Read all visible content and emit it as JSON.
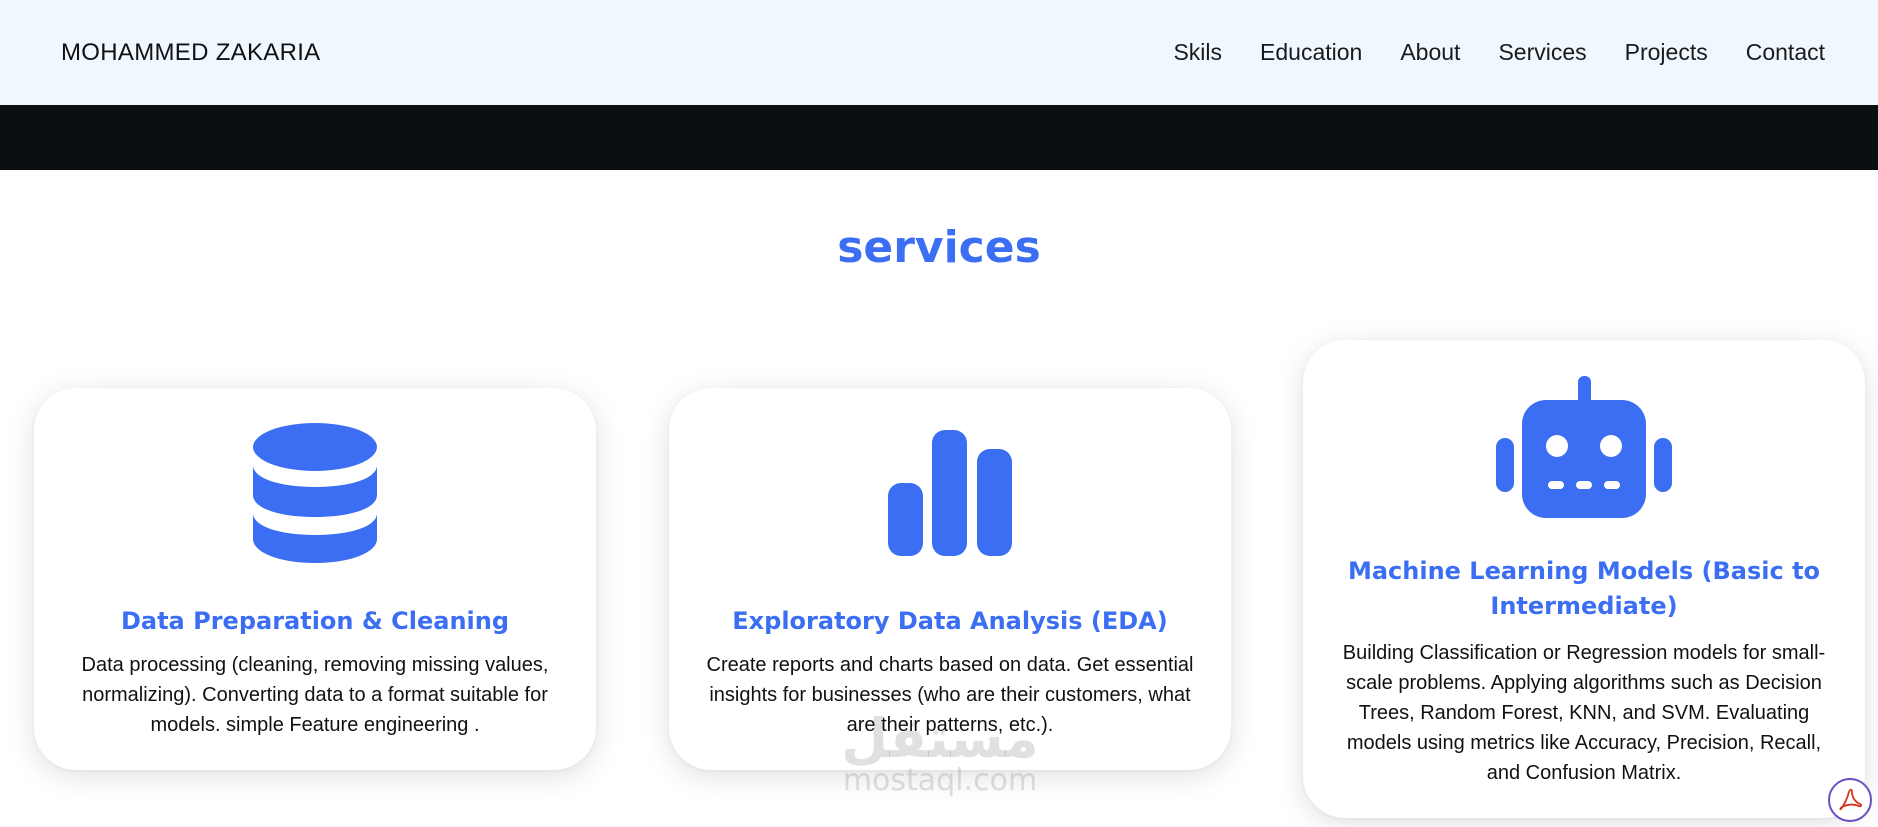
{
  "header": {
    "brand": "MOHAMMED ZAKARIA",
    "nav": [
      "Skils",
      "Education",
      "About",
      "Services",
      "Projects",
      "Contact"
    ]
  },
  "section": {
    "title": "services"
  },
  "cards": [
    {
      "icon": "database-icon",
      "title": "Data Preparation & Cleaning",
      "text": "Data processing (cleaning, removing missing values, normalizing). Converting data to a format suitable for models. simple Feature engineering ."
    },
    {
      "icon": "bar-chart-icon",
      "title": "Exploratory Data Analysis (EDA)",
      "text": "Create reports and charts based on data. Get essential insights for businesses (who are their customers, what are their patterns, etc.)."
    },
    {
      "icon": "robot-icon",
      "title": "Machine Learning Models (Basic to Intermediate)",
      "text": "Building Classification or Regression models for small-scale problems. Applying algorithms such as Decision Trees, Random Forest, KNN, and SVM. Evaluating models using metrics like Accuracy, Precision, Recall, and Confusion Matrix."
    }
  ],
  "watermark": {
    "arabic": "مستقل",
    "latin": "mostaql.com"
  },
  "colors": {
    "accent": "#3b6ef2",
    "header_bg": "#eff7ff",
    "dark_band": "#0b0f14"
  }
}
